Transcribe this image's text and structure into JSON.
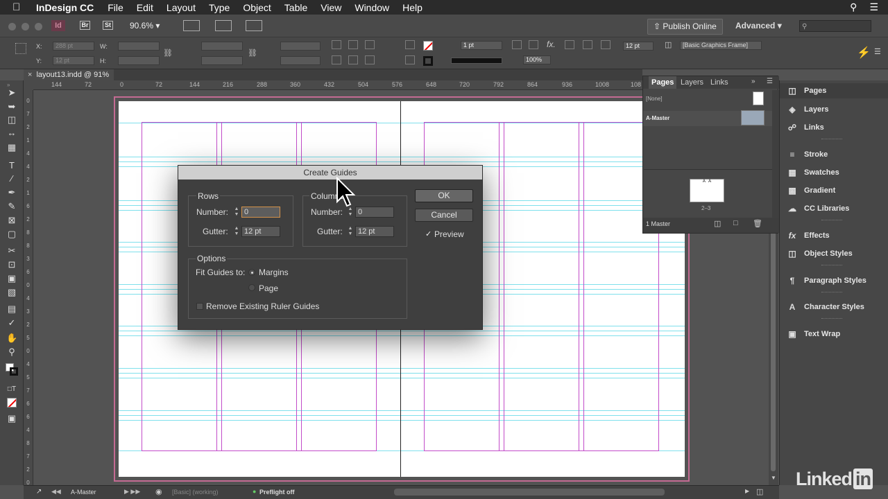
{
  "menubar": {
    "apple_icon": "apple-icon",
    "app_name": "InDesign CC",
    "items": [
      "File",
      "Edit",
      "Layout",
      "Type",
      "Object",
      "Table",
      "View",
      "Window",
      "Help"
    ]
  },
  "appbar": {
    "badge_br": "Br",
    "badge_st": "St",
    "zoom": "90.6%",
    "publish_label": "Publish Online",
    "workspace": "Advanced"
  },
  "control": {
    "x_label": "X:",
    "x_value": "288 pt",
    "y_label": "Y:",
    "y_value": "12 pt",
    "w_label": "W:",
    "h_label": "H:",
    "stroke_weight": "1 pt",
    "opacity": "100%",
    "gutter": "12 pt",
    "object_style": "[Basic Graphics Frame]"
  },
  "document": {
    "tab_title": "layout13.indd @ 91%"
  },
  "ruler": {
    "labels": [
      "144",
      "72",
      "0",
      "72",
      "144",
      "216",
      "288",
      "360",
      "432",
      "504",
      "576",
      "648",
      "720",
      "792",
      "864",
      "936",
      "1008",
      "108"
    ],
    "v_labels": [
      "0",
      "7",
      "2",
      "1",
      "4",
      "4",
      "2",
      "1",
      "6",
      "2",
      "8",
      "8",
      "3",
      "6",
      "0",
      "4",
      "3",
      "2",
      "5",
      "0",
      "4",
      "5",
      "7",
      "6",
      "6",
      "4",
      "8",
      "7",
      "2",
      "0"
    ]
  },
  "dialog": {
    "title": "Create Guides",
    "rows_label": "Rows",
    "columns_label": "Columns",
    "rows_number_label": "Number:",
    "rows_number_value": "0",
    "rows_gutter_label": "Gutter:",
    "rows_gutter_value": "12 pt",
    "cols_number_label": "Number:",
    "cols_number_value": "0",
    "cols_gutter_label": "Gutter:",
    "cols_gutter_value": "12 pt",
    "options_label": "Options",
    "fit_label": "Fit Guides to:",
    "fit_margins": "Margins",
    "fit_page": "Page",
    "remove_label": "Remove Existing Ruler Guides",
    "ok": "OK",
    "cancel": "Cancel",
    "preview": "Preview",
    "preview_checked": true,
    "fit_selected": "Margins"
  },
  "pages_panel": {
    "tabs": [
      "Pages",
      "Layers",
      "Links"
    ],
    "active_tab": "Pages",
    "none_master": "[None]",
    "a_master": "A-Master",
    "spread_label": "2–3",
    "footer": "1 Master"
  },
  "dock": {
    "items": [
      {
        "label": "Pages",
        "icon": "pages-icon"
      },
      {
        "label": "Layers",
        "icon": "layers-icon"
      },
      {
        "label": "Links",
        "icon": "links-icon"
      },
      {
        "label": "Stroke",
        "icon": "stroke-icon"
      },
      {
        "label": "Swatches",
        "icon": "swatches-icon"
      },
      {
        "label": "Gradient",
        "icon": "gradient-icon"
      },
      {
        "label": "CC Libraries",
        "icon": "cc-libraries-icon"
      },
      {
        "label": "Effects",
        "icon": "effects-icon"
      },
      {
        "label": "Object Styles",
        "icon": "object-styles-icon"
      },
      {
        "label": "Paragraph Styles",
        "icon": "paragraph-styles-icon"
      },
      {
        "label": "Character Styles",
        "icon": "character-styles-icon"
      },
      {
        "label": "Text Wrap",
        "icon": "text-wrap-icon"
      }
    ]
  },
  "statusbar": {
    "page": "A-Master",
    "profile": "[Basic] (working)",
    "preflight": "Preflight off"
  },
  "watermark": "Linked"
}
